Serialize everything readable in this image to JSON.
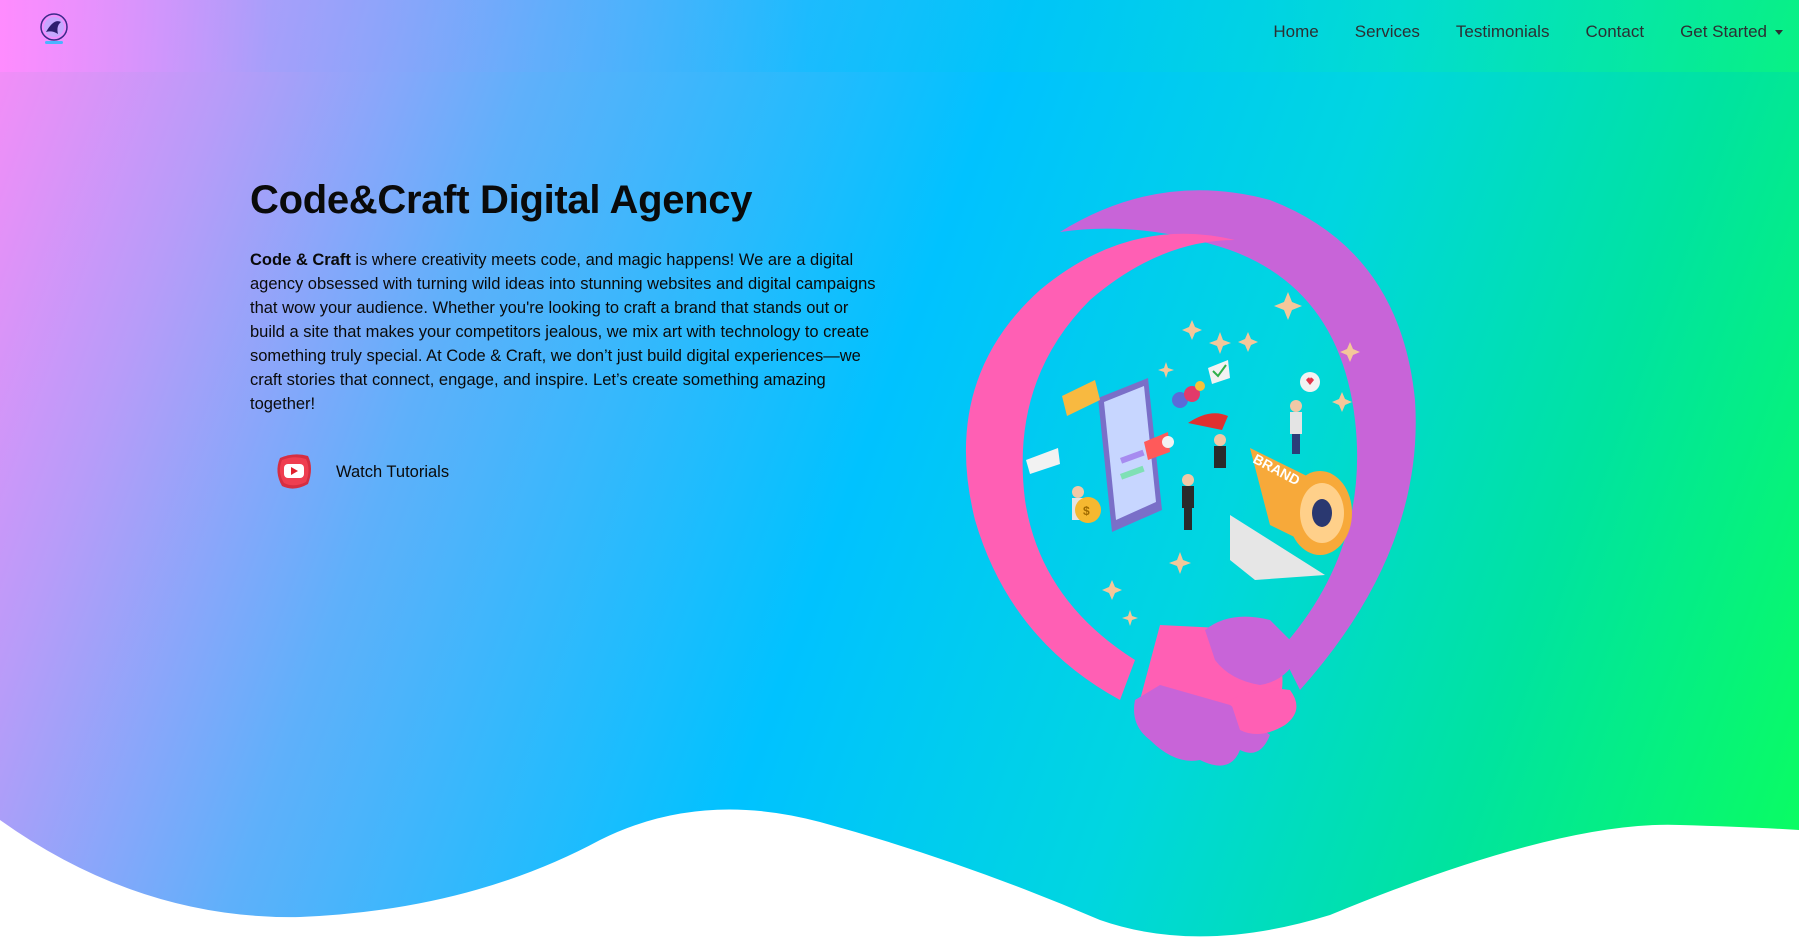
{
  "nav": {
    "items": [
      "Home",
      "Services",
      "Testimonials",
      "Contact"
    ],
    "dropdown_label": "Get Started"
  },
  "hero": {
    "title": "Code&Craft Digital Agency",
    "desc_bold": "Code & Craft",
    "desc_rest": " is where creativity meets code, and magic happens! We are a digital agency obsessed with turning wild ideas into stunning websites and digital campaigns that wow your audience. Whether you're looking to craft a brand that stands out or build a site that makes your competitors jealous, we mix art with technology to create something truly special. At Code & Craft, we don’t just build digital experiences—we craft stories that connect, engage, and inspire. Let’s create something amazing together!",
    "watch_label": "Watch Tutorials",
    "illustration_text": "BRAND"
  },
  "colors": {
    "ring_pink": "#ff5fb4",
    "ring_purple": "#c864d8",
    "youtube_red": "#e0202c",
    "wave": "#ffffff"
  },
  "icons": {
    "logo": "agency-logo-icon",
    "youtube": "youtube-play-icon"
  }
}
